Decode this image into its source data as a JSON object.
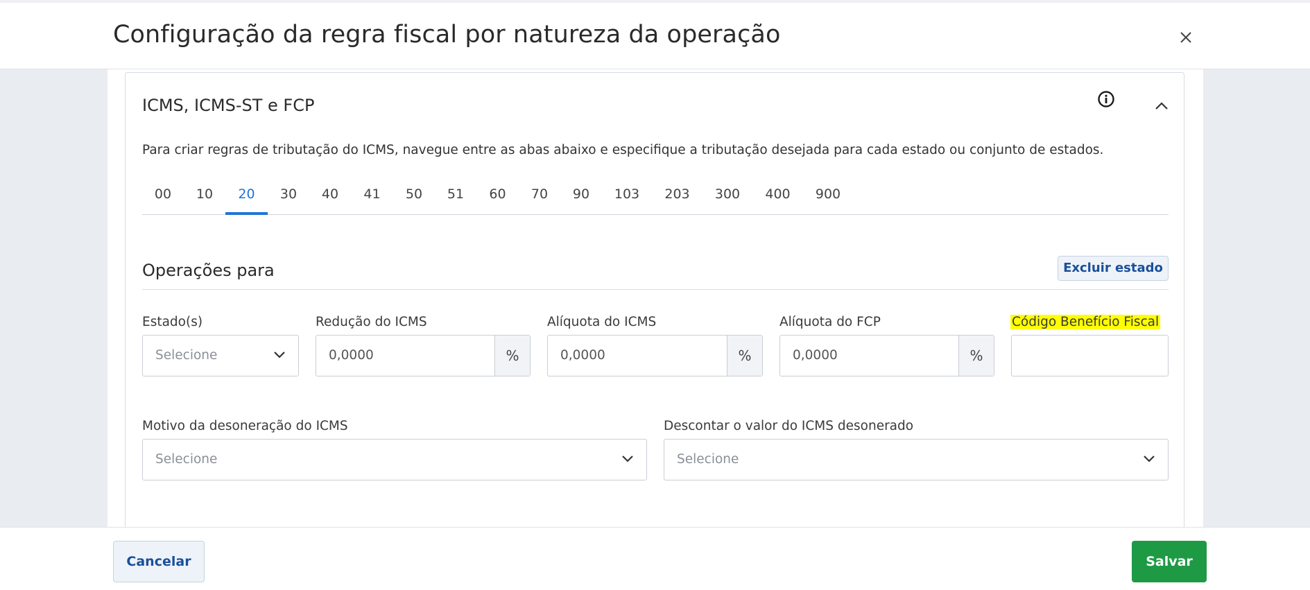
{
  "header": {
    "title": "Configuração da regra fiscal por natureza da operação"
  },
  "section": {
    "title": "ICMS, ICMS-ST e FCP",
    "description": "Para criar regras de tributação do ICMS, navegue entre as abas abaixo e especifique a tributação desejada para cada estado ou conjunto de estados.",
    "tabs": [
      "00",
      "10",
      "20",
      "30",
      "40",
      "41",
      "50",
      "51",
      "60",
      "70",
      "90",
      "103",
      "203",
      "300",
      "400",
      "900"
    ],
    "active_tab": "20"
  },
  "operations": {
    "title": "Operações para",
    "delete_state_label": "Excluir estado",
    "estado": {
      "label": "Estado(s)",
      "placeholder": "Selecione"
    },
    "reducao": {
      "label": "Redução do ICMS",
      "value": "0,0000",
      "suffix": "%"
    },
    "aliquota_icms": {
      "label": "Alíquota do ICMS",
      "value": "0,0000",
      "suffix": "%"
    },
    "aliquota_fcp": {
      "label": "Alíquota do FCP",
      "value": "0,0000",
      "suffix": "%"
    },
    "codigo_beneficio": {
      "label": "Código Benefício Fiscal",
      "value": ""
    },
    "motivo": {
      "label": "Motivo da desoneração do ICMS",
      "placeholder": "Selecione"
    },
    "descontar": {
      "label": "Descontar o valor do ICMS desonerado",
      "placeholder": "Selecione"
    }
  },
  "footer": {
    "cancel_label": "Cancelar",
    "save_label": "Salvar"
  },
  "colors": {
    "accent": "#1f74d6",
    "primary_button": "#1e9a45",
    "secondary_button_text": "#1a4f9c",
    "highlight": "#ffff00"
  },
  "icons": [
    "close-icon",
    "info-icon",
    "chevron-up-icon",
    "chevron-down-icon"
  ]
}
